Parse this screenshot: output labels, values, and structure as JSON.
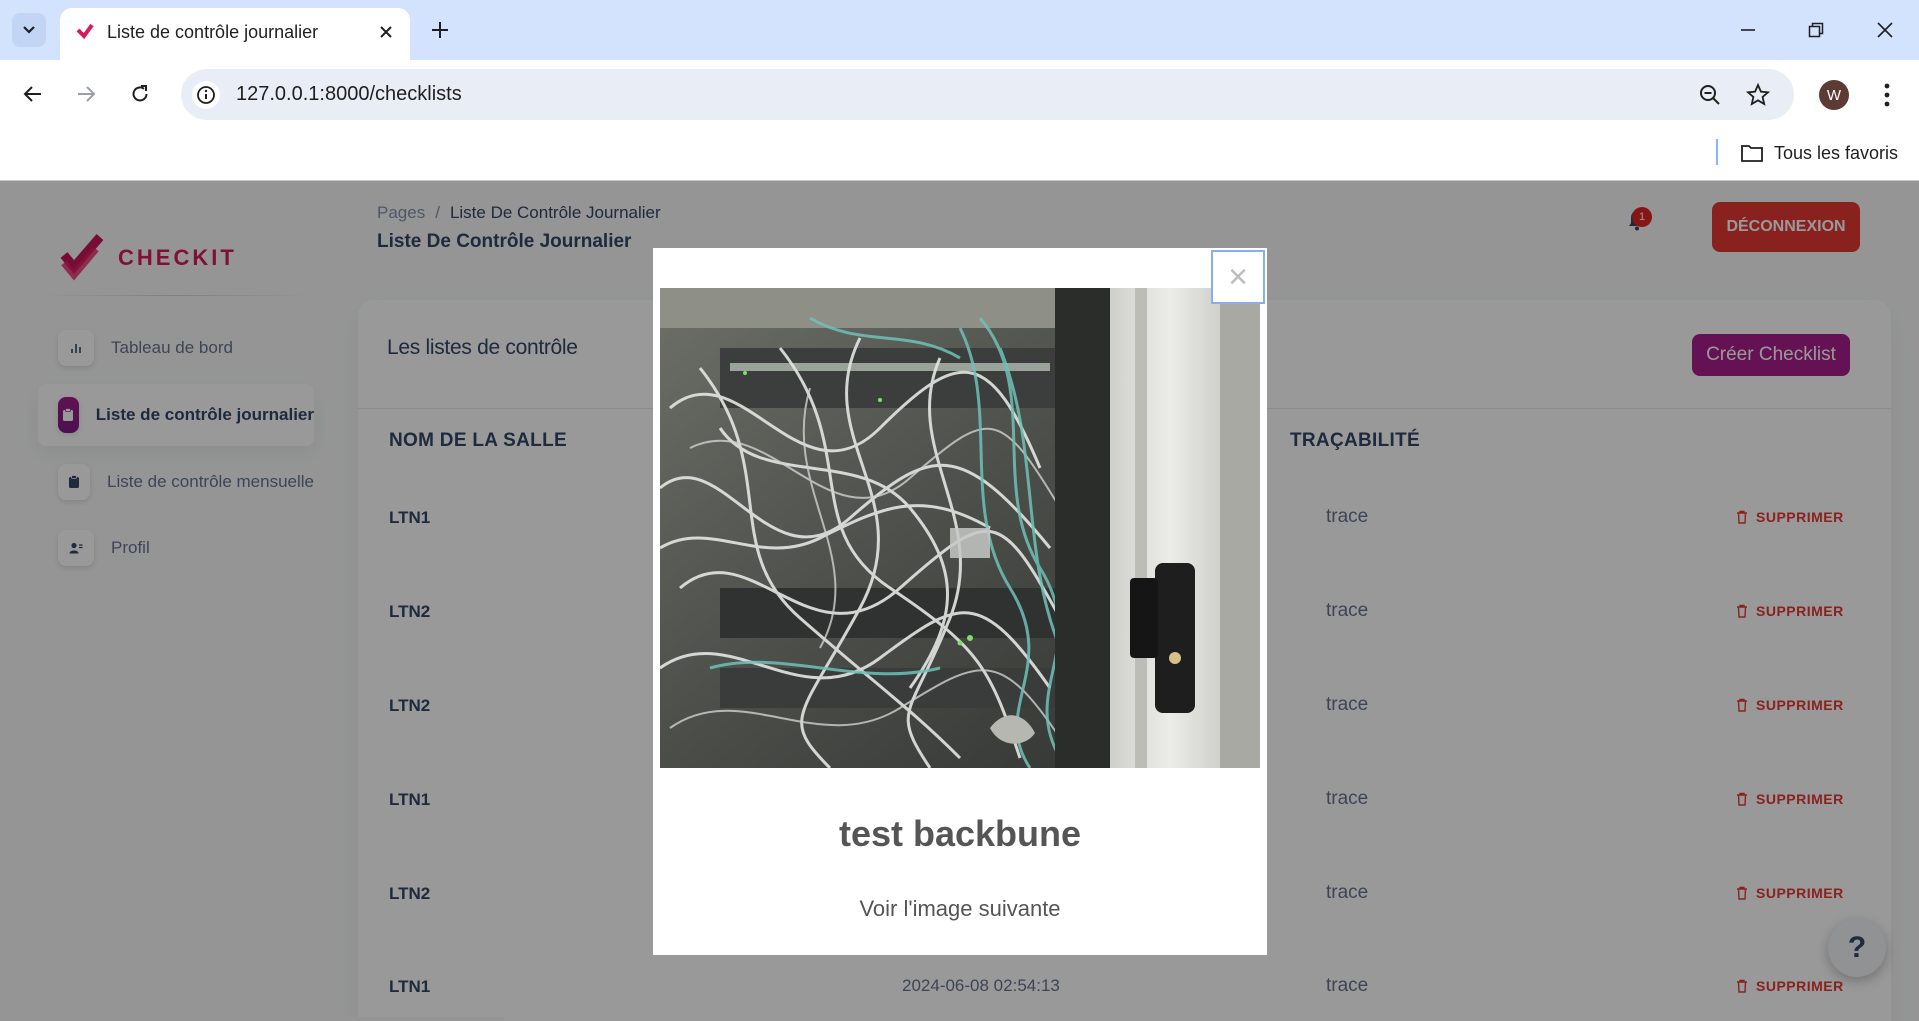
{
  "browser": {
    "tab_title": "Liste de contrôle journalier",
    "url": "127.0.0.1:8000/checklists",
    "bookmarks_folder": "Tous les favoris",
    "profile_initial": "W"
  },
  "app": {
    "logo_text": "CHECKIT",
    "brand_color": "#d81b60",
    "accent_color": "#a91e8e",
    "sidebar": {
      "items": [
        {
          "label": "Tableau de bord",
          "icon": "bar-chart-icon"
        },
        {
          "label": "Liste de contrôle journalier",
          "icon": "clipboard-icon",
          "active": true
        },
        {
          "label": "Liste de contrôle mensuelle",
          "icon": "clipboard-icon"
        },
        {
          "label": "Profil",
          "icon": "user-icon"
        }
      ]
    },
    "breadcrumb": {
      "root": "Pages",
      "separator": "/",
      "current": "Liste De Contrôle Journalier"
    },
    "page_title": "Liste De Contrôle Journalier",
    "notifications_count": "1",
    "logout_label": "DÉCONNEXION"
  },
  "card": {
    "title": "Les listes de contrôle",
    "create_label": "Créer Checklist",
    "columns": [
      "NOM DE LA SALLE",
      "TRAÇABILITÉ"
    ],
    "rows": [
      {
        "name": "LTN1",
        "trace": "trace",
        "action": "SUPPRIMER"
      },
      {
        "name": "LTN2",
        "trace": "trace",
        "action": "SUPPRIMER"
      },
      {
        "name": "LTN2",
        "trace": "trace",
        "action": "SUPPRIMER"
      },
      {
        "name": "LTN1",
        "trace": "trace",
        "action": "SUPPRIMER"
      },
      {
        "name": "LTN2",
        "trace": "trace",
        "action": "SUPPRIMER"
      },
      {
        "name": "LTN1",
        "date": "2024-06-08 02:54:13",
        "trace": "trace",
        "action": "SUPPRIMER"
      }
    ]
  },
  "modal": {
    "close_symbol": "×",
    "caption": "test backbune",
    "next_label": "Voir l'image suivante"
  },
  "help_symbol": "?"
}
